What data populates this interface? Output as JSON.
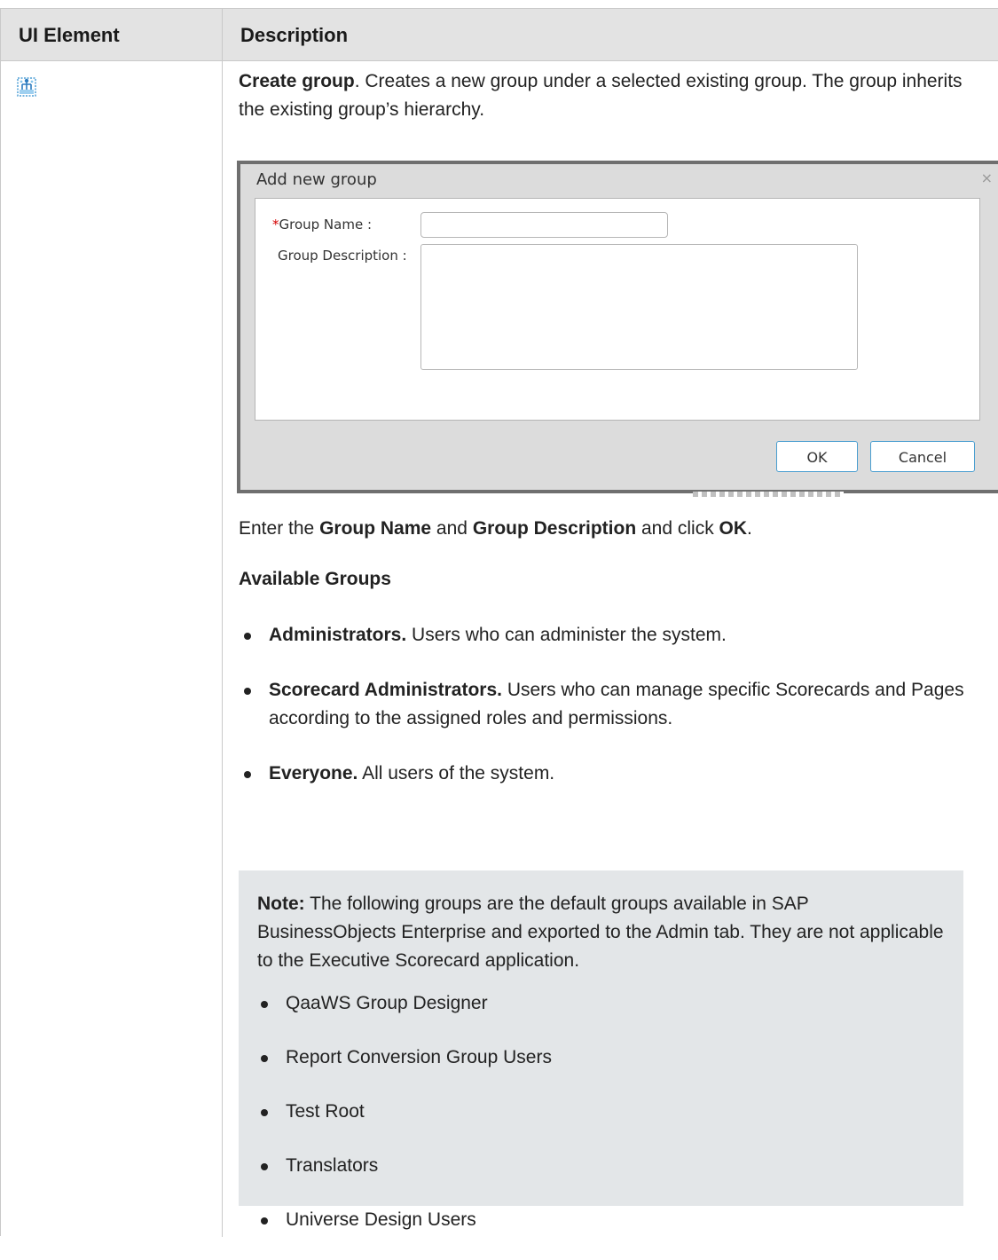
{
  "table": {
    "headers": [
      "UI Element",
      "Description"
    ]
  },
  "row": {
    "icon": "create-group-icon",
    "intro_title": "Create group",
    "intro_text": ". Creates a new group under a selected existing group. The group inherits the existing group’s hierarchy.",
    "dialog": {
      "title": "Add new group",
      "close": "×",
      "required_mark": "*",
      "group_name_label": "Group Name :",
      "group_description_label": "Group Description :",
      "group_name_value": "",
      "group_description_value": "",
      "ok_label": "OK",
      "cancel_label": "Cancel"
    },
    "enter_text": {
      "p1": "Enter the ",
      "b1": "Group Name",
      "p2": " and ",
      "b2": "Group Description",
      "p3": " and click ",
      "b3": "OK",
      "p4": "."
    },
    "available_heading": "Available Groups",
    "groups": [
      {
        "name": "Administrators.",
        "text": " Users who can administer the system."
      },
      {
        "name": "Scorecard Administrators.",
        "text": " Users who can manage specific Scorecards and Pages according to the assigned roles and permissions."
      },
      {
        "name": "Everyone.",
        "text": " All users of the system."
      }
    ],
    "note": {
      "label": "Note:",
      "text": " The following groups are the default groups available in SAP BusinessObjects Enterprise and exported to the Admin tab. They are not applicable to the Executive Scorecard application.",
      "items": [
        "QaaWS Group Designer",
        "Report Conversion Group Users",
        "Test Root",
        "Translators",
        "Universe Design Users"
      ]
    }
  },
  "colors": {
    "header_bg": "#e3e3e3",
    "note_bg": "#e3e6e8",
    "required": "#d40000",
    "button_border": "#4a9ed0"
  }
}
